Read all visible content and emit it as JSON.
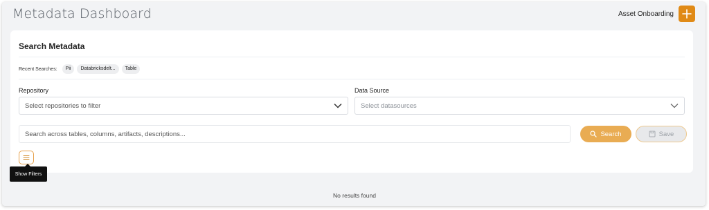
{
  "header": {
    "title": "Metadata Dashboard",
    "onboarding_label": "Asset Onboarding",
    "onboarding_icon": "plus-icon"
  },
  "search_card": {
    "title": "Search Metadata",
    "recent_label": "Recent Searches:",
    "recent_searches": [
      "Pii",
      "Databricksdelt...",
      "Table"
    ],
    "repository": {
      "label": "Repository",
      "placeholder": "Select repositories to filter"
    },
    "data_source": {
      "label": "Data Source",
      "placeholder": "Select datasources"
    },
    "search_input": {
      "placeholder": "Search across tables, columns, artifacts, descriptions..."
    },
    "search_button": "Search",
    "save_button": "Save",
    "filter_tooltip": "Show Filters"
  },
  "results": {
    "message": "No results found"
  },
  "colors": {
    "accent": "#e08a16",
    "search_button": "#e9ac53",
    "background": "#f2f3f5"
  }
}
